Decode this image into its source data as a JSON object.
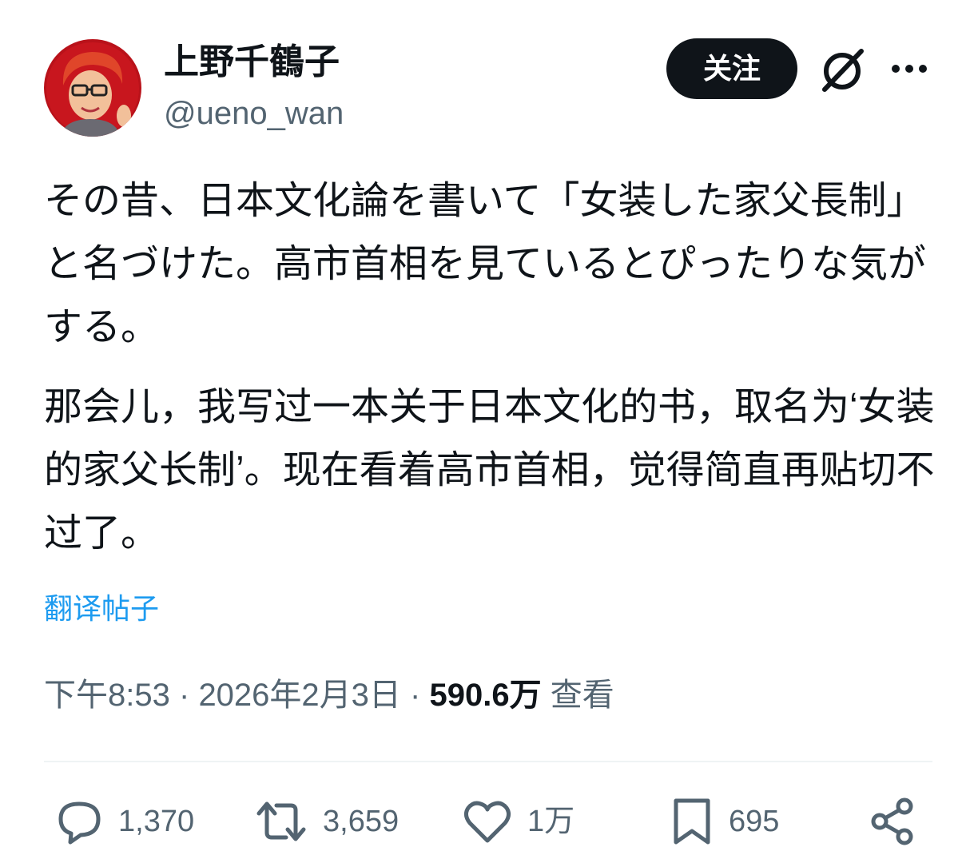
{
  "author": {
    "display_name": "上野千鶴子",
    "handle": "@ueno_wan",
    "avatar_icon": "avatar-bitmoji-icon"
  },
  "header": {
    "follow_label": "关注",
    "grok_icon": "grok-icon",
    "more_icon": "more-options-icon"
  },
  "tweet": {
    "text_ja": "その昔、日本文化論を書いて「女装した家父長制」と名づけた。高市首相を見ているとぴったりな気がする。",
    "text_zh": "那会儿，我写过一本关于日本文化的书，取名为‘女装的家父长制’。现在看着高市首相，觉得简直再贴切不过了。",
    "translate_label": "翻译帖子",
    "time": "下午8:53",
    "date": "2026年2月3日",
    "separator": "·",
    "views_count": "590.6万",
    "views_label": "查看"
  },
  "actions": {
    "replies": "1,370",
    "retweets": "3,659",
    "likes": "1万",
    "bookmarks": "695"
  },
  "colors": {
    "text_primary": "#0f1419",
    "text_secondary": "#536471",
    "link": "#1d9bf0",
    "button_bg": "#0f1419",
    "divider": "#eff3f4"
  }
}
